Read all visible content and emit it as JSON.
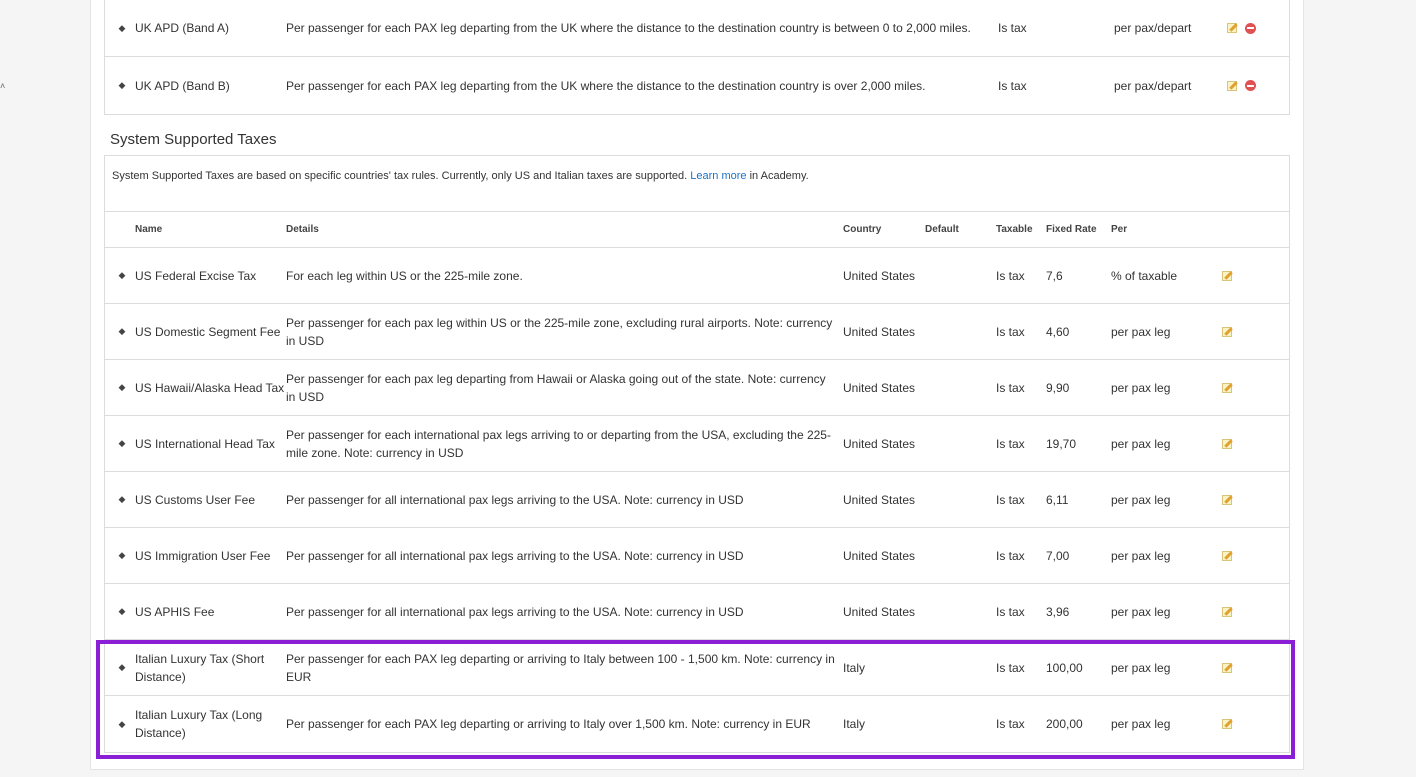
{
  "upper_table": {
    "rows": [
      {
        "name": "UK APD (Band A)",
        "details": "Per passenger for each PAX leg departing from the UK where the distance to the destination country is between 0 to 2,000 miles.",
        "taxable": "Is tax",
        "per": "per pax/depart"
      },
      {
        "name": "UK APD (Band B)",
        "details": "Per passenger for each PAX leg departing from the UK where the distance to the destination country is over 2,000 miles.",
        "taxable": "Is tax",
        "per": "per pax/depart"
      }
    ]
  },
  "system_taxes": {
    "title": "System Supported Taxes",
    "info_before": "System Supported Taxes are based on specific countries' tax rules. Currently, only US and Italian taxes are supported. ",
    "info_link": "Learn more",
    "info_after": " in Academy.",
    "headers": {
      "name": "Name",
      "details": "Details",
      "country": "Country",
      "default": "Default",
      "taxable": "Taxable",
      "rate": "Fixed Rate",
      "per": "Per"
    },
    "rows": [
      {
        "name": "US Federal Excise Tax",
        "details": "For each leg within US or the 225-mile zone.",
        "country": "United States",
        "default": "",
        "taxable": "Is tax",
        "rate": "7,6",
        "per": "% of taxable"
      },
      {
        "name": "US Domestic Segment Fee",
        "details": "Per passenger for each pax leg within US or the 225-mile zone, excluding rural airports. Note: currency in USD",
        "country": "United States",
        "default": "",
        "taxable": "Is tax",
        "rate": "4,60",
        "per": "per pax leg"
      },
      {
        "name": "US Hawaii/Alaska Head Tax",
        "details": "Per passenger for each pax leg departing from Hawaii or Alaska going out of the state. Note: currency in USD",
        "country": "United States",
        "default": "",
        "taxable": "Is tax",
        "rate": "9,90",
        "per": "per pax leg"
      },
      {
        "name": "US International Head Tax",
        "details": "Per passenger for each international pax legs arriving to or departing from the USA, excluding the 225-mile zone. Note: currency in USD",
        "country": "United States",
        "default": "",
        "taxable": "Is tax",
        "rate": "19,70",
        "per": "per pax leg"
      },
      {
        "name": "US Customs User Fee",
        "details": "Per passenger for all international pax legs arriving to the USA. Note: currency in USD",
        "country": "United States",
        "default": "",
        "taxable": "Is tax",
        "rate": "6,11",
        "per": "per pax leg"
      },
      {
        "name": "US Immigration User Fee",
        "details": "Per passenger for all international pax legs arriving to the USA. Note: currency in USD",
        "country": "United States",
        "default": "",
        "taxable": "Is tax",
        "rate": "7,00",
        "per": "per pax leg"
      },
      {
        "name": "US APHIS Fee",
        "details": "Per passenger for all international pax legs arriving to the USA. Note: currency in USD",
        "country": "United States",
        "default": "",
        "taxable": "Is tax",
        "rate": "3,96",
        "per": "per pax leg"
      },
      {
        "name": "Italian Luxury Tax (Short Distance)",
        "details": "Per passenger for each PAX leg departing or arriving to Italy between 100 - 1,500 km. Note: currency in EUR",
        "country": "Italy",
        "default": "",
        "taxable": "Is tax",
        "rate": "100,00",
        "per": "per pax leg"
      },
      {
        "name": "Italian Luxury Tax (Long Distance)",
        "details": "Per passenger for each PAX leg departing or arriving to Italy over 1,500 km. Note: currency in EUR",
        "country": "Italy",
        "default": "",
        "taxable": "Is tax",
        "rate": "200,00",
        "per": "per pax leg"
      }
    ]
  },
  "icons": {
    "drag": "sort-handle-icon",
    "edit": "edit-pencil-icon",
    "delete": "delete-circle-icon"
  },
  "colors": {
    "highlight": "#8a1fd6",
    "link": "#1a73c7",
    "delete": "#e05252"
  }
}
